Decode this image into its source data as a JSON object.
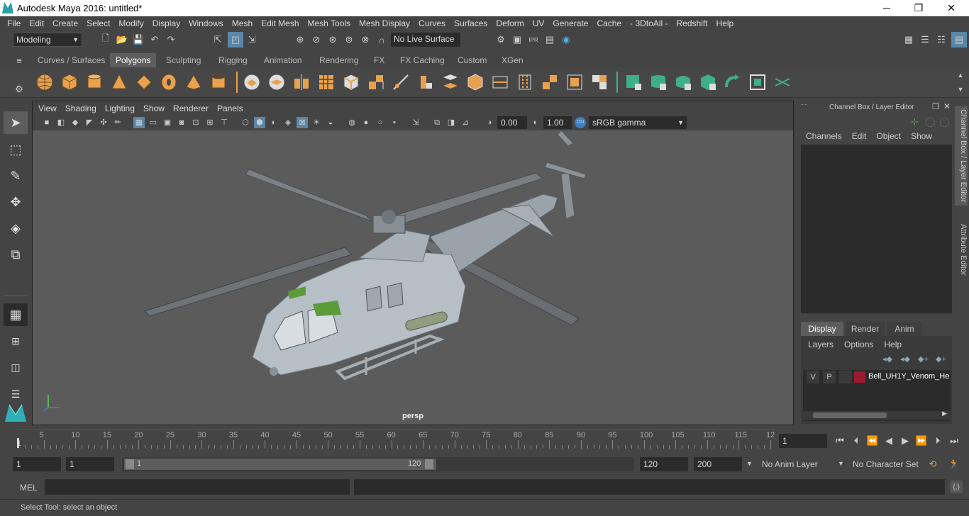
{
  "window": {
    "title": "Autodesk Maya 2016: untitled*",
    "minimize": "─",
    "maximize": "❐",
    "close": "✕"
  },
  "menubar": [
    "File",
    "Edit",
    "Create",
    "Select",
    "Modify",
    "Display",
    "Windows",
    "Mesh",
    "Edit Mesh",
    "Mesh Tools",
    "Mesh Display",
    "Curves",
    "Surfaces",
    "Deform",
    "UV",
    "Generate",
    "Cache",
    "- 3DtoAll -",
    "Redshift",
    "Help"
  ],
  "statusline": {
    "mode": "Modeling",
    "live_surface": "No Live Surface"
  },
  "shelf_tabs": [
    "Curves / Surfaces",
    "Polygons",
    "Sculpting",
    "Rigging",
    "Animation",
    "Rendering",
    "FX",
    "FX Caching",
    "Custom",
    "XGen"
  ],
  "shelf_active": "Polygons",
  "viewport": {
    "menu": [
      "View",
      "Shading",
      "Lighting",
      "Show",
      "Renderer",
      "Panels"
    ],
    "exposure": "0.00",
    "gamma": "1.00",
    "color_space": "sRGB gamma",
    "camera_label": "persp"
  },
  "channel_box": {
    "title": "Channel Box / Layer Editor",
    "menu": [
      "Channels",
      "Edit",
      "Object",
      "Show"
    ]
  },
  "layer_editor": {
    "tabs": [
      "Display",
      "Render",
      "Anim"
    ],
    "active_tab": "Display",
    "menu": [
      "Layers",
      "Options",
      "Help"
    ],
    "layers": [
      {
        "v": "V",
        "p": "P",
        "name": "Bell_UH1Y_Venom_Hel",
        "color": "#9b1b2e"
      }
    ]
  },
  "side_tabs": [
    "Channel Box / Layer Editor",
    "Attribute Editor"
  ],
  "timeline": {
    "ticks": [
      "1",
      "5",
      "10",
      "15",
      "20",
      "25",
      "30",
      "35",
      "40",
      "45",
      "50",
      "55",
      "60",
      "65",
      "70",
      "75",
      "80",
      "85",
      "90",
      "95",
      "100",
      "105",
      "110",
      "115",
      "12"
    ],
    "current_frame": "1"
  },
  "range": {
    "start": "1",
    "playback_start": "1",
    "slider_start": "1",
    "slider_end": "120",
    "playback_end": "120",
    "end": "200",
    "anim_layer": "No Anim Layer",
    "character_set": "No Character Set"
  },
  "command": {
    "label": "MEL"
  },
  "help_line": "Select Tool: select an object",
  "colors": {
    "accent": "#e8a14f",
    "shelf_green": "#3fae8a",
    "viewport_bg": "#5b5b5b"
  }
}
